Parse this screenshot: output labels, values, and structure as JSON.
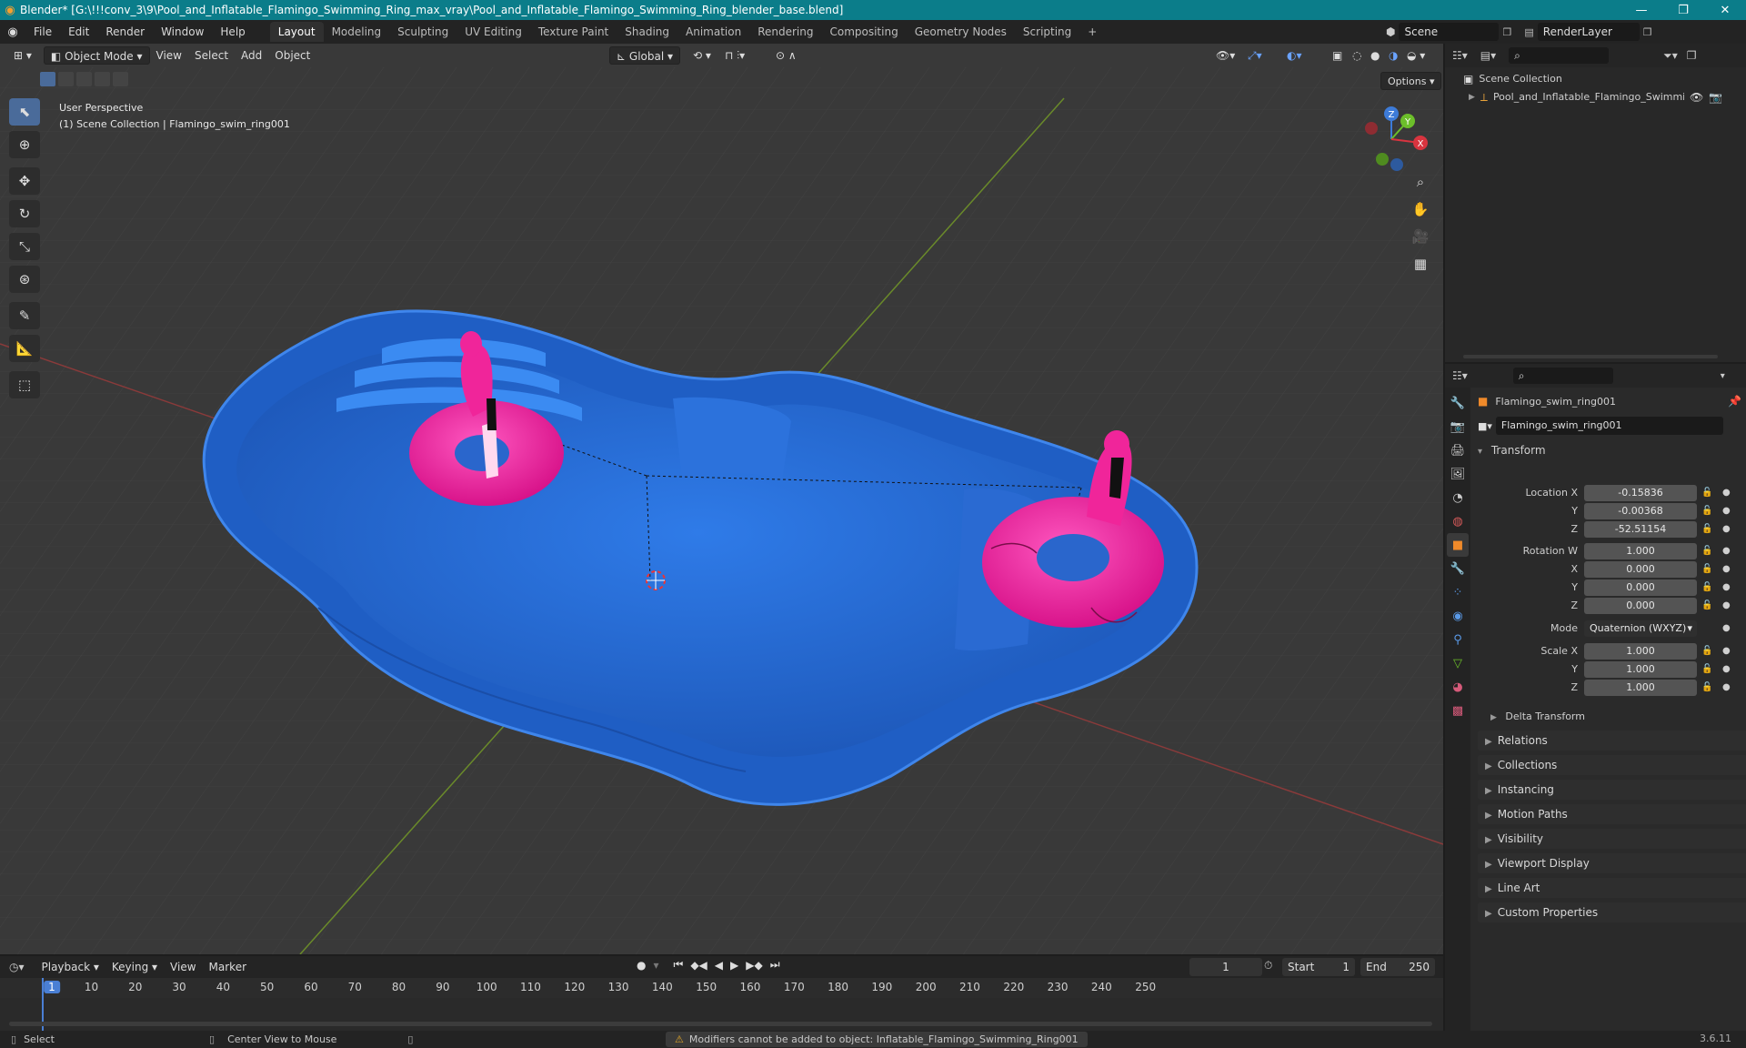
{
  "window": {
    "title": "Blender* [G:\\!!!conv_3\\9\\Pool_and_Inflatable_Flamingo_Swimming_Ring_max_vray\\Pool_and_Inflatable_Flamingo_Swimming_Ring_blender_base.blend]"
  },
  "menu": {
    "items": [
      "File",
      "Edit",
      "Render",
      "Window",
      "Help"
    ]
  },
  "workspaces": {
    "tabs": [
      "Layout",
      "Modeling",
      "Sculpting",
      "UV Editing",
      "Texture Paint",
      "Shading",
      "Animation",
      "Rendering",
      "Compositing",
      "Geometry Nodes",
      "Scripting"
    ],
    "active": "Layout",
    "add_symbol": "+"
  },
  "scene": {
    "name": "Scene",
    "render_layer": "RenderLayer"
  },
  "viewport": {
    "mode": "Object Mode",
    "menus": [
      "View",
      "Select",
      "Add",
      "Object"
    ],
    "transform_orientation": "Global",
    "options_label": "Options",
    "overlay_line1": "User Perspective",
    "overlay_line2": "(1) Scene Collection | Flamingo_swim_ring001",
    "axis_labels": {
      "x": "X",
      "y": "Y",
      "z": "Z"
    }
  },
  "outliner": {
    "root": "Scene Collection",
    "items": [
      {
        "name": "Pool_and_Inflatable_Flamingo_Swimmir"
      }
    ]
  },
  "properties": {
    "object_name": "Flamingo_swim_ring001",
    "data_name": "Flamingo_swim_ring001",
    "transform_header": "Transform",
    "location": {
      "label_x": "Location X",
      "label_y": "Y",
      "label_z": "Z",
      "x": "-0.15836",
      "y": "-0.00368",
      "z": "-52.51154"
    },
    "rotation": {
      "label_w": "Rotation W",
      "label_x": "X",
      "label_y": "Y",
      "label_z": "Z",
      "w": "1.000",
      "x": "0.000",
      "y": "0.000",
      "z": "0.000"
    },
    "mode_label": "Mode",
    "mode_value": "Quaternion (WXYZ)",
    "scale": {
      "label_x": "Scale X",
      "label_y": "Y",
      "label_z": "Z",
      "x": "1.000",
      "y": "1.000",
      "z": "1.000"
    },
    "delta_transform": "Delta Transform",
    "panels": [
      "Relations",
      "Collections",
      "Instancing",
      "Motion Paths",
      "Visibility",
      "Viewport Display",
      "Line Art",
      "Custom Properties"
    ]
  },
  "timeline": {
    "menus": [
      "Playback",
      "Keying",
      "View",
      "Marker"
    ],
    "current_frame": "1",
    "start_label": "Start",
    "start": "1",
    "end_label": "End",
    "end": "250",
    "ticks": [
      "1",
      "10",
      "20",
      "30",
      "40",
      "50",
      "60",
      "70",
      "80",
      "90",
      "100",
      "110",
      "120",
      "130",
      "140",
      "150",
      "160",
      "170",
      "180",
      "190",
      "200",
      "210",
      "220",
      "230",
      "240",
      "250"
    ]
  },
  "status": {
    "left": "Select",
    "middle": "Center View to Mouse",
    "warning": "Modifiers cannot be added to object: Inflatable_Flamingo_Swimming_Ring001",
    "version": "3.6.11"
  },
  "colors": {
    "titlebar": "#0b7d8a",
    "pool": "#2b6fd6",
    "flamingo": "#f0259a",
    "accent": "#4a7fd4",
    "warning": "#e0a528"
  }
}
